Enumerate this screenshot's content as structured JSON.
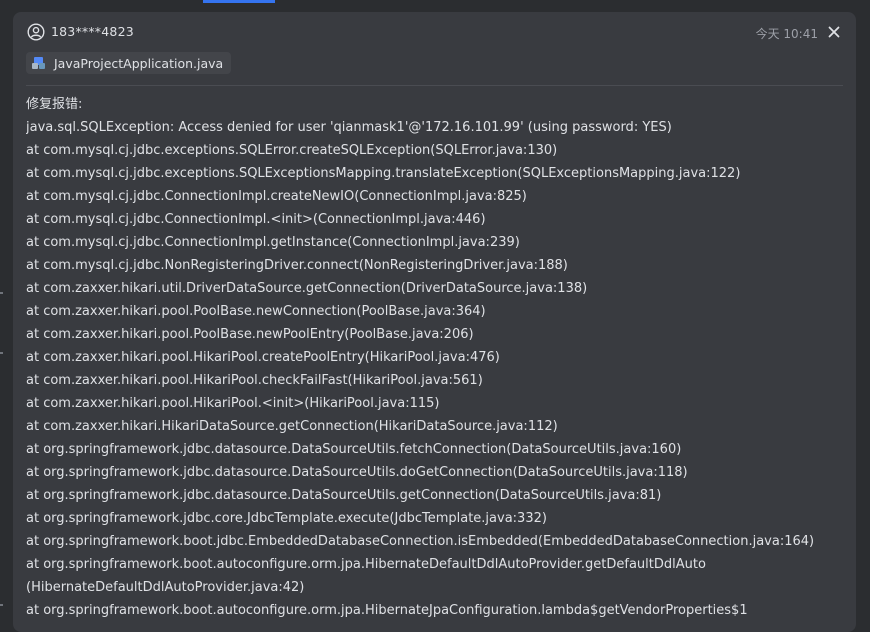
{
  "header": {
    "user_name": "183****4823",
    "timestamp": "今天 10:41"
  },
  "attachment": {
    "file_name": "JavaProjectApplication.java"
  },
  "message": {
    "lines": [
      "修复报错:",
      "java.sql.SQLException: Access denied for user 'qianmask1'@'172.16.101.99' (using password: YES)",
      "at com.mysql.cj.jdbc.exceptions.SQLError.createSQLException(SQLError.java:130)",
      "at com.mysql.cj.jdbc.exceptions.SQLExceptionsMapping.translateException(SQLExceptionsMapping.java:122)",
      "at com.mysql.cj.jdbc.ConnectionImpl.createNewIO(ConnectionImpl.java:825)",
      "at com.mysql.cj.jdbc.ConnectionImpl.<init>(ConnectionImpl.java:446)",
      "at com.mysql.cj.jdbc.ConnectionImpl.getInstance(ConnectionImpl.java:239)",
      "at com.mysql.cj.jdbc.NonRegisteringDriver.connect(NonRegisteringDriver.java:188)",
      "at com.zaxxer.hikari.util.DriverDataSource.getConnection(DriverDataSource.java:138)",
      "at com.zaxxer.hikari.pool.PoolBase.newConnection(PoolBase.java:364)",
      "at com.zaxxer.hikari.pool.PoolBase.newPoolEntry(PoolBase.java:206)",
      "at com.zaxxer.hikari.pool.HikariPool.createPoolEntry(HikariPool.java:476)",
      "at com.zaxxer.hikari.pool.HikariPool.checkFailFast(HikariPool.java:561)",
      "at com.zaxxer.hikari.pool.HikariPool.<init>(HikariPool.java:115)",
      "at com.zaxxer.hikari.HikariDataSource.getConnection(HikariDataSource.java:112)",
      "at org.springframework.jdbc.datasource.DataSourceUtils.fetchConnection(DataSourceUtils.java:160)",
      "at org.springframework.jdbc.datasource.DataSourceUtils.doGetConnection(DataSourceUtils.java:118)",
      "at org.springframework.jdbc.datasource.DataSourceUtils.getConnection(DataSourceUtils.java:81)",
      "at org.springframework.jdbc.core.JdbcTemplate.execute(JdbcTemplate.java:332)",
      "at org.springframework.boot.jdbc.EmbeddedDatabaseConnection.isEmbedded(EmbeddedDatabaseConnection.java:164)",
      "at org.springframework.boot.autoconfigure.orm.jpa.HibernateDefaultDdlAutoProvider.getDefaultDdlAuto",
      "(HibernateDefaultDdlAutoProvider.java:42)",
      "at org.springframework.boot.autoconfigure.orm.jpa.HibernateJpaConfiguration.lambda$getVendorProperties$1"
    ]
  },
  "icons": {
    "user": "user-circle-icon",
    "close": "close-icon",
    "file": "java-file-icon"
  },
  "colors": {
    "background": "#2b2d30",
    "card": "#393b40",
    "text": "#dfe1e5",
    "muted": "#9da0a8",
    "accent": "#3574f0"
  }
}
